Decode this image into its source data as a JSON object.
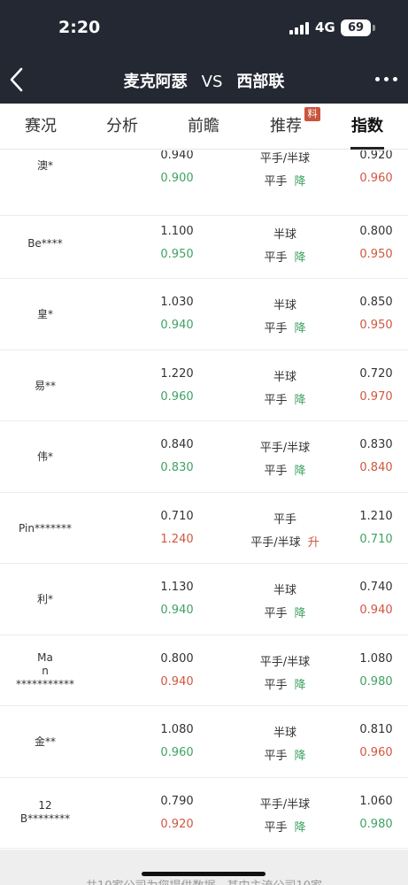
{
  "status_bar": {
    "time": "2:20",
    "network": "4G",
    "battery": "69"
  },
  "nav": {
    "home_team": "麦克阿瑟",
    "vs": "VS",
    "away_team": "西部联"
  },
  "tabs": [
    {
      "label": "赛况"
    },
    {
      "label": "分析"
    },
    {
      "label": "前瞻"
    },
    {
      "label": "推荐",
      "badge": "料"
    },
    {
      "label": "指数",
      "active": true
    }
  ],
  "rows": [
    {
      "company": "澳*",
      "home_now": "0.940",
      "line_now": "平手/半球",
      "away_now": "0.920",
      "home_init": "0.900",
      "line_init": "平手",
      "move": "降",
      "away_init": "0.960"
    },
    {
      "company": "Be****",
      "home_now": "1.100",
      "line_now": "半球",
      "away_now": "0.800",
      "home_init": "0.950",
      "line_init": "平手",
      "move": "降",
      "away_init": "0.950"
    },
    {
      "company": "皇*",
      "home_now": "1.030",
      "line_now": "半球",
      "away_now": "0.850",
      "home_init": "0.940",
      "line_init": "平手",
      "move": "降",
      "away_init": "0.950"
    },
    {
      "company": "易**",
      "home_now": "1.220",
      "line_now": "半球",
      "away_now": "0.720",
      "home_init": "0.960",
      "line_init": "平手",
      "move": "降",
      "away_init": "0.970"
    },
    {
      "company": "伟*",
      "home_now": "0.840",
      "line_now": "平手/半球",
      "away_now": "0.830",
      "home_init": "0.830",
      "line_init": "平手",
      "move": "降",
      "away_init": "0.840"
    },
    {
      "company": "Pin*******",
      "home_now": "0.710",
      "line_now": "平手",
      "away_now": "1.210",
      "home_init": "1.240",
      "line_init": "平手/半球",
      "move": "升",
      "away_init": "0.710"
    },
    {
      "company": "利*",
      "home_now": "1.130",
      "line_now": "半球",
      "away_now": "0.740",
      "home_init": "0.940",
      "line_init": "平手",
      "move": "降",
      "away_init": "0.940"
    },
    {
      "company_lines": [
        "Ma",
        "n",
        "***********"
      ],
      "home_now": "0.800",
      "line_now": "平手/半球",
      "away_now": "1.080",
      "home_init": "0.940",
      "line_init": "平手",
      "move": "降",
      "away_init": "0.980"
    },
    {
      "company": "金**",
      "home_now": "1.080",
      "line_now": "半球",
      "away_now": "0.810",
      "home_init": "0.960",
      "line_init": "平手",
      "move": "降",
      "away_init": "0.960"
    },
    {
      "company_lines": [
        "12",
        "B********"
      ],
      "home_now": "0.790",
      "line_now": "平手/半球",
      "away_now": "1.060",
      "home_init": "0.920",
      "line_init": "平手",
      "move": "降",
      "away_init": "0.980"
    }
  ],
  "footer": {
    "text": "共10家公司为您提供数据，其中主流公司10家"
  },
  "colors": {
    "header_bg": "#232833",
    "up": "#d0573f",
    "down": "#3fa263",
    "badge": "#c9553c"
  }
}
